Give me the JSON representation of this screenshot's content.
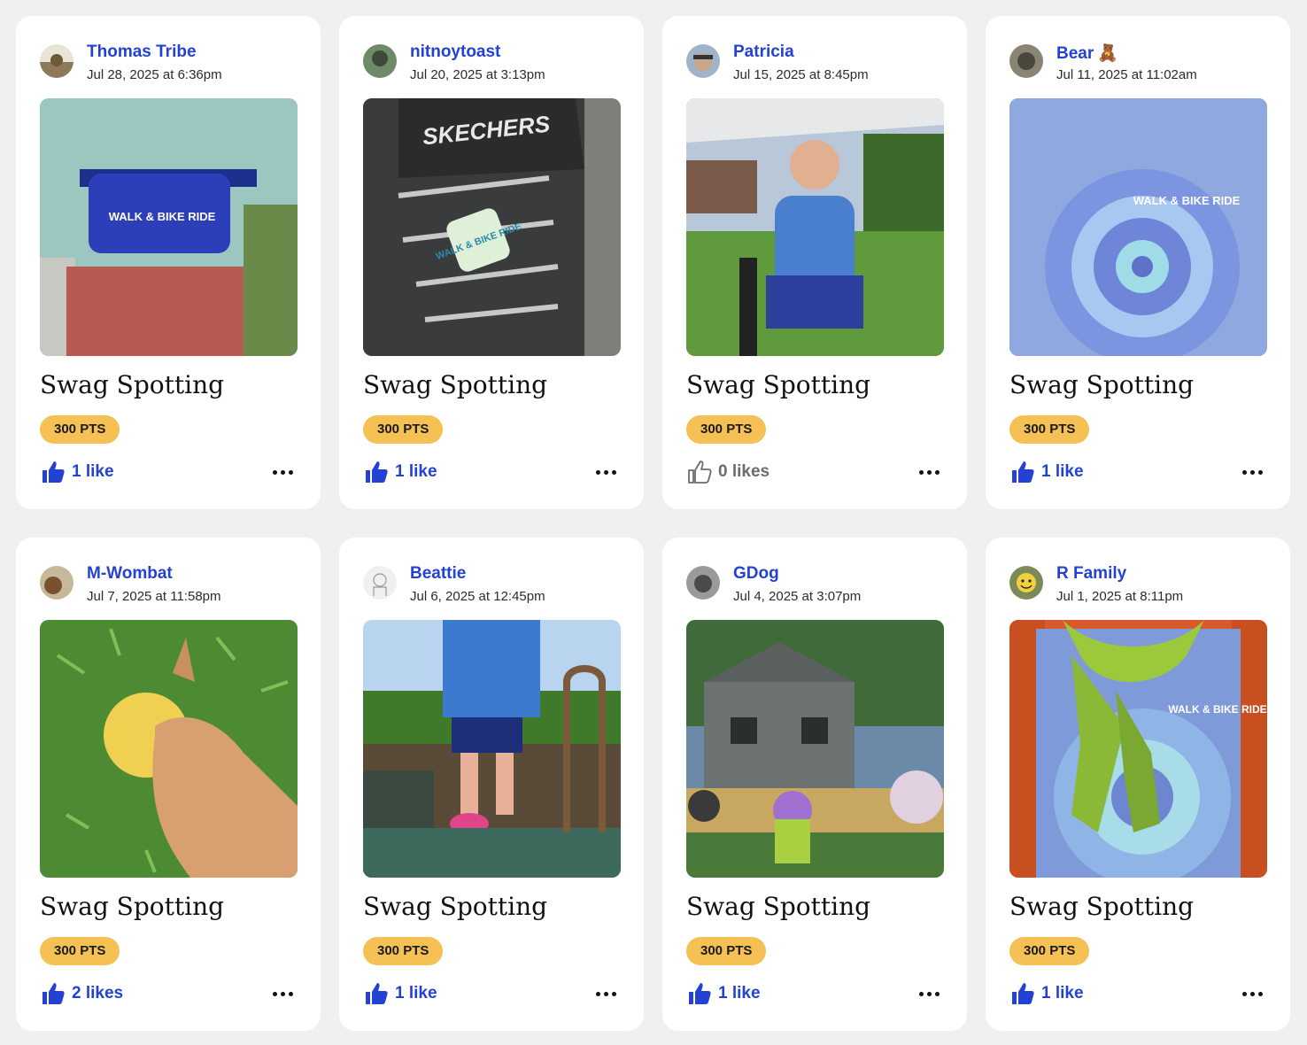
{
  "posts": [
    {
      "author": "Thomas Tribe",
      "emoji": "",
      "date": "Jul 28, 2025 at 6:36pm",
      "title": "Swag Spotting",
      "points": "300 PTS",
      "likes": "1 like",
      "liked": true,
      "photo": "fanny-pack-photo",
      "photo_logo": "WALK & BIKE RIDE",
      "avatar_color": "#9a8a6a"
    },
    {
      "author": "nitnoytoast",
      "emoji": "",
      "date": "Jul 20, 2025 at 3:13pm",
      "title": "Swag Spotting",
      "points": "300 PTS",
      "likes": "1 like",
      "liked": true,
      "photo": "sneaker-sticker-photo",
      "photo_brand": "SKECHERS",
      "photo_logo": "WALK & BIKE RIDE",
      "avatar_color": "#5e7a5a"
    },
    {
      "author": "Patricia",
      "emoji": "",
      "date": "Jul 15, 2025 at 8:45pm",
      "title": "Swag Spotting",
      "points": "300 PTS",
      "likes": "0 likes",
      "liked": false,
      "photo": "woman-in-park-photo",
      "avatar_color": "#7c8fa6"
    },
    {
      "author": "Bear",
      "emoji": "🧸",
      "date": "Jul 11, 2025 at 11:02am",
      "title": "Swag Spotting",
      "points": "300 PTS",
      "likes": "1 like",
      "liked": true,
      "photo": "tie-dye-shirt-photo",
      "photo_logo": "WALK & BIKE RIDE",
      "avatar_color": "#6f6a5c"
    },
    {
      "author": "M-Wombat",
      "emoji": "",
      "date": "Jul 7, 2025 at 11:58pm",
      "title": "Swag Spotting",
      "points": "300 PTS",
      "likes": "2 likes",
      "liked": true,
      "photo": "dog-on-grass-photo",
      "avatar_color": "#8a6a4a"
    },
    {
      "author": "Beattie",
      "emoji": "",
      "date": "Jul 6, 2025 at 12:45pm",
      "title": "Swag Spotting",
      "points": "300 PTS",
      "likes": "1 like",
      "liked": true,
      "photo": "child-on-playground-photo",
      "avatar_color": "#e8e8e8"
    },
    {
      "author": "GDog",
      "emoji": "",
      "date": "Jul 4, 2025 at 3:07pm",
      "title": "Swag Spotting",
      "points": "300 PTS",
      "likes": "1 like",
      "liked": true,
      "photo": "bike-ride-group-photo",
      "avatar_color": "#6a6a6a"
    },
    {
      "author": "R Family",
      "emoji": "",
      "date": "Jul 1, 2025 at 8:11pm",
      "title": "Swag Spotting",
      "points": "300 PTS",
      "likes": "1 like",
      "liked": true,
      "photo": "cooling-towel-shirt-photo",
      "photo_logo": "WALK & BIKE RIDE",
      "avatar_color": "#7c8a5a"
    }
  ],
  "colors": {
    "page_bg": "#f2efef",
    "card_bg": "#ffffff",
    "link_blue": "#2342d4",
    "points_badge": "#f6c154",
    "muted_gray": "#6b6b6b"
  },
  "icons": {
    "like_filled": "thumbs-up-filled-icon",
    "like_outline": "thumbs-up-outline-icon",
    "more": "more-horizontal-icon"
  }
}
